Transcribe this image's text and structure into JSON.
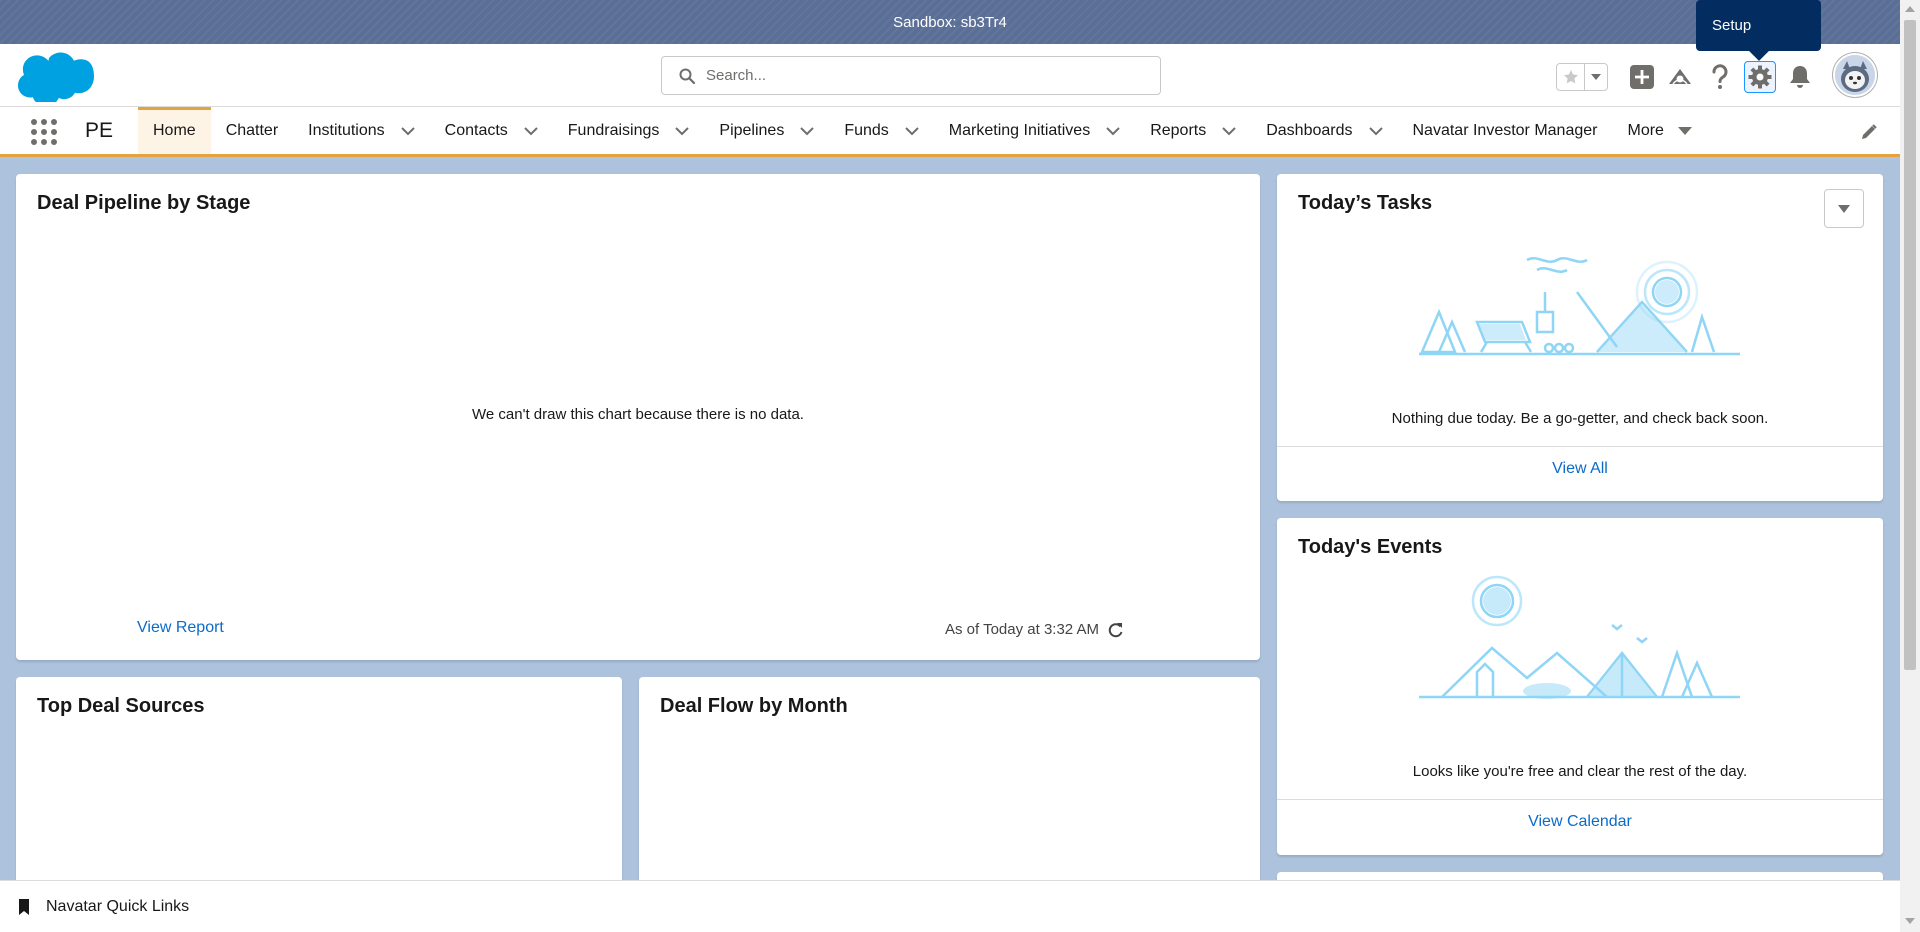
{
  "sandbox_banner": {
    "text": "Sandbox: sb3Tr4"
  },
  "header": {
    "search_placeholder": "Search...",
    "tooltip": "Setup",
    "icons": [
      "salesforce-logo",
      "search-icon",
      "star-icon",
      "chevron-down-icon",
      "plus-icon",
      "trailhead-icon",
      "help-icon",
      "gear-icon",
      "bell-icon",
      "avatar"
    ]
  },
  "nav": {
    "app_name": "PE",
    "items": [
      {
        "label": "Home",
        "active": true,
        "dropdown": false
      },
      {
        "label": "Chatter",
        "dropdown": false
      },
      {
        "label": "Institutions",
        "dropdown": true
      },
      {
        "label": "Contacts",
        "dropdown": true
      },
      {
        "label": "Fundraisings",
        "dropdown": true
      },
      {
        "label": "Pipelines",
        "dropdown": true
      },
      {
        "label": "Funds",
        "dropdown": true
      },
      {
        "label": "Marketing Initiatives",
        "dropdown": true
      },
      {
        "label": "Reports",
        "dropdown": true
      },
      {
        "label": "Dashboards",
        "dropdown": true
      },
      {
        "label": "Navatar Investor Manager",
        "dropdown": false
      },
      {
        "label": "More",
        "dropdown": true
      }
    ]
  },
  "pipeline_card": {
    "title": "Deal Pipeline by Stage",
    "empty_message": "We can't draw this chart because there is no data.",
    "view_report": "View Report",
    "as_of": "As of Today at 3:32 AM"
  },
  "tasks_card": {
    "title": "Today’s Tasks",
    "message": "Nothing due today. Be a go-getter, and check back soon.",
    "link": "View All"
  },
  "events_card": {
    "title": "Today's Events",
    "message": "Looks like you're free and clear the rest of the day.",
    "link": "View Calendar"
  },
  "sources_card": {
    "title": "Top Deal Sources"
  },
  "flow_card": {
    "title": "Deal Flow by Month"
  },
  "utility_bar": {
    "label": "Navatar Quick Links"
  },
  "colors": {
    "brand_blue": "#00a1e0",
    "link_blue": "#0b6bcb",
    "nav_accent": "#e3a33f",
    "tooltip_bg": "#032d60",
    "illustration_blue": "#8fd5f6"
  }
}
